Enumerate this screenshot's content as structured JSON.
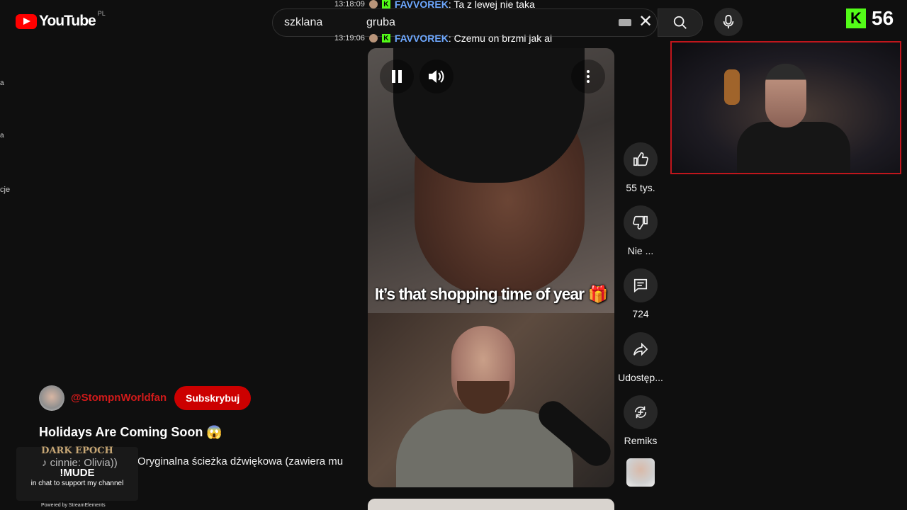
{
  "header": {
    "logo_text": "YouTube",
    "country_code": "PL",
    "search_word1": "szklana",
    "search_word2": "gruba",
    "search_icon": "search-icon",
    "mic_icon": "mic-icon"
  },
  "chat": [
    {
      "time": "13:18:09",
      "user": "FAVVOREK",
      "message": ": Ta z lewej nie taka"
    },
    {
      "time": "13:19:06",
      "user": "FAVVOREK",
      "message": ": Czemu on brzmi jak ai"
    }
  ],
  "kick": {
    "logo": "K",
    "viewers": "56"
  },
  "video": {
    "caption": "It’s that shopping time of year 🎁"
  },
  "actions": {
    "like_count": "55 tys.",
    "dislike_label": "Nie ...",
    "comments_count": "724",
    "share_label": "Udostęp...",
    "remix_label": "Remiks"
  },
  "channel": {
    "name": "@StompnWorldfan",
    "subscribe_label": "Subskrybuj"
  },
  "short_title": "Holidays Are Coming Soon 😱",
  "music_line": "Oryginalna ścieżka dźwiękowa (zawiera mu",
  "sidebar_fragments": [
    "a",
    "a",
    "cje"
  ],
  "stream_elements": {
    "game": "DARK EPOCH",
    "sub": "cinnie: Olivia))",
    "command": "!MUDE",
    "text": "in chat to support my channel",
    "footer": "Powered by StreamElements"
  },
  "colors": {
    "accent_red": "#cc0000",
    "kick_green": "#53fc18",
    "chat_name": "#6ea8ff"
  }
}
